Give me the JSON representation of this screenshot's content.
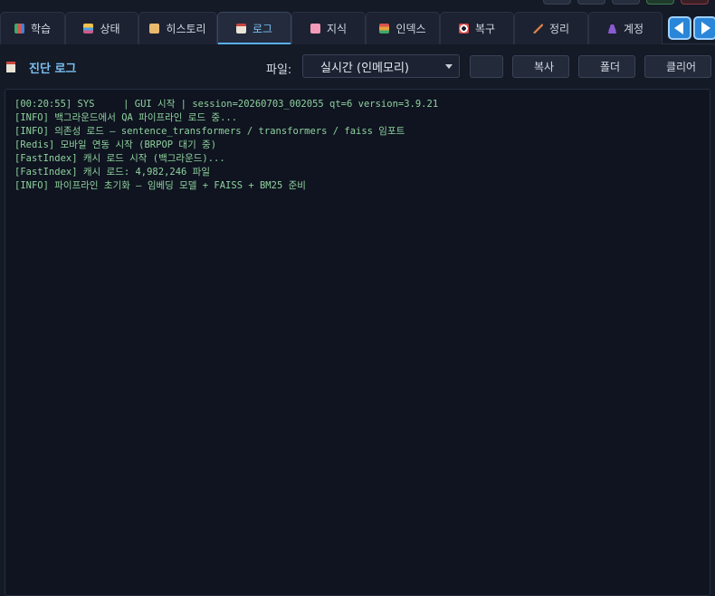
{
  "tabs": [
    {
      "label": "학습",
      "icon": "books-icon"
    },
    {
      "label": "상태",
      "icon": "chart-icon"
    },
    {
      "label": "히스토리",
      "icon": "scroll-icon"
    },
    {
      "label": "로그",
      "icon": "memo-icon",
      "active": true
    },
    {
      "label": "지식",
      "icon": "brain-icon"
    },
    {
      "label": "인덱스",
      "icon": "index-icon"
    },
    {
      "label": "복구",
      "icon": "ring-buoy-icon"
    },
    {
      "label": "정리",
      "icon": "broom-icon"
    },
    {
      "label": "계정",
      "icon": "user-icon"
    }
  ],
  "panel": {
    "title": "진단 로그",
    "title_icon": "memo-icon",
    "file_label": "파일:",
    "file_select": {
      "value": "실시간 (인메모리)",
      "icon": "scroll-icon"
    },
    "buttons": {
      "refresh": {
        "label": "",
        "icon": "refresh-icon"
      },
      "copy": {
        "label": "복사",
        "icon": "clipboard-icon"
      },
      "folder": {
        "label": "폴더",
        "icon": "folder-icon"
      },
      "clear": {
        "label": "클리어",
        "icon": "trash-icon"
      }
    }
  },
  "log": {
    "lines": [
      "[00:20:55] SYS     | GUI 시작 | session=20260703_002055 qt=6 version=3.9.21",
      "[INFO] 백그라운드에서 QA 파이프라인 로드 중...",
      "[INFO] 의존성 로드 — sentence_transformers / transformers / faiss 임포트",
      "[Redis] 모바일 연동 시작 (BRPOP 대기 중)",
      "[FastIndex] 캐시 로드 시작 (백그라운드)...",
      "[FastIndex] 캐시 로드: 4,982,246 파일",
      "[INFO] 파이프라인 초기화 — 임베딩 모델 + FAISS + BM25 준비"
    ]
  },
  "colors": {
    "accent": "#7cc0f2",
    "log_text": "#8fd19e",
    "background": "#141a26",
    "nav_button": "#2a86d8"
  }
}
